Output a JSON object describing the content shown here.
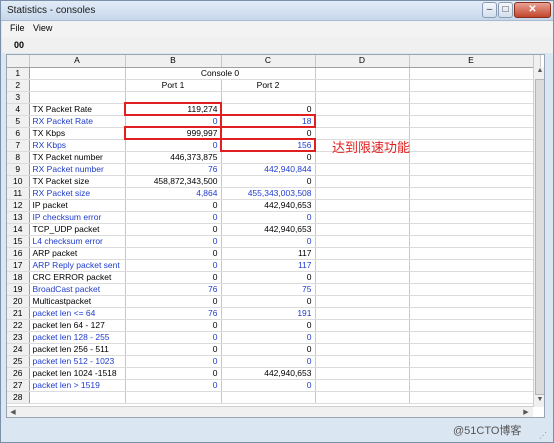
{
  "window": {
    "title": "Statistics - consoles"
  },
  "controls": {
    "minimize": "–",
    "maximize": "□",
    "close": "✕"
  },
  "menu": {
    "file": "File",
    "view": "View"
  },
  "toolbar": {
    "code": "00"
  },
  "grid": {
    "columns": [
      "A",
      "B",
      "C",
      "D",
      "E"
    ],
    "group_header": "Console 0",
    "port1": "Port 1",
    "port2": "Port 2",
    "rows": [
      {
        "label": "TX Packet Rate",
        "p1": "119,274",
        "p2": "0",
        "blue": false
      },
      {
        "label": "RX Packet Rate",
        "p1": "0",
        "p2": "18",
        "blue": true
      },
      {
        "label": "TX Kbps",
        "p1": "999,997",
        "p2": "0",
        "blue": false
      },
      {
        "label": "RX Kbps",
        "p1": "0",
        "p2": "156",
        "blue": true
      },
      {
        "label": "TX Packet number",
        "p1": "446,373,875",
        "p2": "0",
        "blue": false
      },
      {
        "label": "RX Packet number",
        "p1": "76",
        "p2": "442,940,844",
        "blue": true
      },
      {
        "label": "TX Packet size",
        "p1": "458,872,343,500",
        "p2": "0",
        "blue": false
      },
      {
        "label": "RX Packet size",
        "p1": "4,864",
        "p2": "455,343,003,508",
        "blue": true
      },
      {
        "label": "IP packet",
        "p1": "0",
        "p2": "442,940,653",
        "blue": false
      },
      {
        "label": "IP checksum error",
        "p1": "0",
        "p2": "0",
        "blue": true
      },
      {
        "label": "TCP_UDP packet",
        "p1": "0",
        "p2": "442,940,653",
        "blue": false
      },
      {
        "label": "L4 checksum error",
        "p1": "0",
        "p2": "0",
        "blue": true
      },
      {
        "label": "ARP packet",
        "p1": "0",
        "p2": "117",
        "blue": false
      },
      {
        "label": "ARP Reply packet sent",
        "p1": "0",
        "p2": "117",
        "blue": true
      },
      {
        "label": "CRC ERROR packet",
        "p1": "0",
        "p2": "0",
        "blue": false
      },
      {
        "label": "BroadCast packet",
        "p1": "76",
        "p2": "75",
        "blue": true
      },
      {
        "label": "Multicastpacket",
        "p1": "0",
        "p2": "0",
        "blue": false
      },
      {
        "label": "packet len <= 64",
        "p1": "76",
        "p2": "191",
        "blue": true
      },
      {
        "label": "packet len 64 - 127",
        "p1": "0",
        "p2": "0",
        "blue": false
      },
      {
        "label": "packet len 128 - 255",
        "p1": "0",
        "p2": "0",
        "blue": true
      },
      {
        "label": "packet len 256 - 511",
        "p1": "0",
        "p2": "0",
        "blue": false
      },
      {
        "label": "packet len 512 - 1023",
        "p1": "0",
        "p2": "0",
        "blue": true
      },
      {
        "label": "packet len 1024 -1518",
        "p1": "0",
        "p2": "442,940,653",
        "blue": false
      },
      {
        "label": "packet len > 1519",
        "p1": "0",
        "p2": "0",
        "blue": true
      }
    ],
    "row_numbers": [
      "1",
      "2",
      "3",
      "4",
      "5",
      "6",
      "7",
      "8",
      "9",
      "10",
      "11",
      "12",
      "13",
      "14",
      "15",
      "16",
      "17",
      "18",
      "19",
      "20",
      "21",
      "22",
      "23",
      "24",
      "25",
      "26",
      "27",
      "28"
    ]
  },
  "highlights": [
    "4-B",
    "5-C",
    "6-B",
    "7-C"
  ],
  "annotation": "达到限速功能",
  "watermark": "@51CTO博客",
  "colors": {
    "blue_text": "#1f3ccc",
    "highlight": "#e02020"
  },
  "icons": {
    "up_arrow": "▲",
    "down_arrow": "▼",
    "left_arrow": "◀",
    "right_arrow": "▶",
    "grip": "⋰"
  }
}
